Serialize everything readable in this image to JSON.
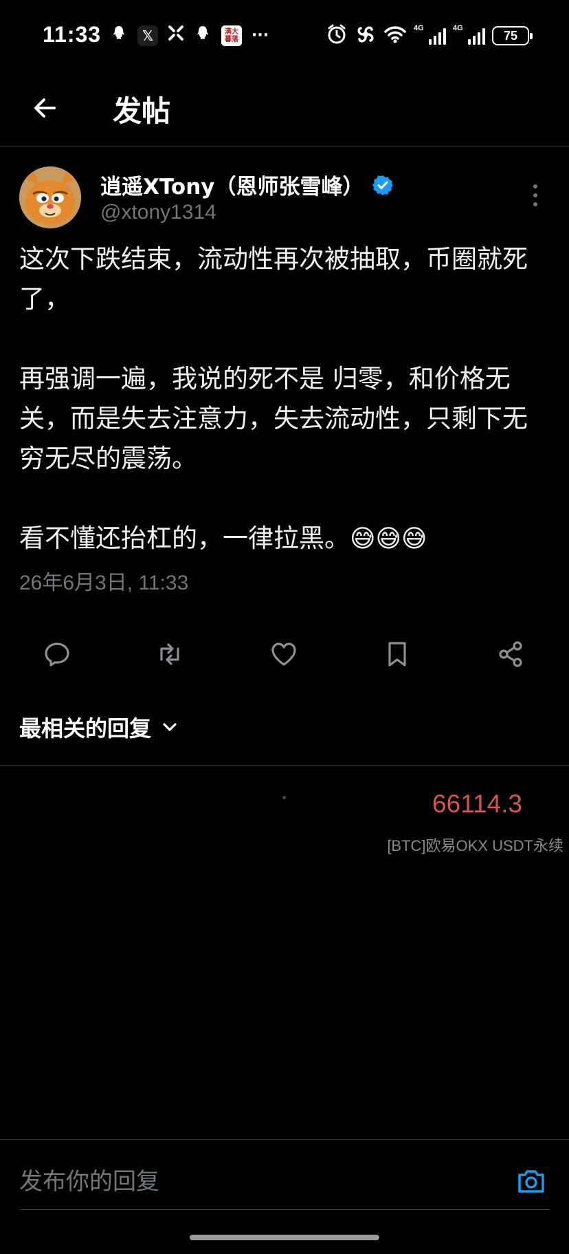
{
  "status_bar": {
    "time": "11:33",
    "left_icons": [
      "qq-icon",
      "x-icon",
      "grid-icon",
      "qq-icon",
      "app-icon",
      "more-icon"
    ],
    "app_icon_text": "满大\n暮落",
    "network_1": "4G",
    "network_2": "4G",
    "battery": "75"
  },
  "header": {
    "title": "发帖"
  },
  "post": {
    "display_name": "逍遥XTony（恩师张雪峰）",
    "handle": "@xtony1314",
    "paragraphs": [
      "这次下跌结束，流动性再次被抽取，币圈就死了，",
      "再强调一遍，我说的死不是 归零，和价格无关，而是失去注意力，失去流动性，只剩下无穷无尽的震荡。",
      "看不懂还抬杠的，一律拉黑。"
    ],
    "emoji": "😅😅😅",
    "timestamp": "26年6月3日, 11:33"
  },
  "actions": [
    "reply-icon",
    "retweet-icon",
    "like-icon",
    "bookmark-icon",
    "share-icon"
  ],
  "replies": {
    "sort_label": "最相关的回复"
  },
  "overlay": {
    "btc_price": "66114.3",
    "btc_label": "[BTC]欧易OKX USDT永续"
  },
  "composer": {
    "placeholder": "发布你的回复"
  },
  "colors": {
    "background": "#000000",
    "accent_blue": "#1d9bf0",
    "secondary_text": "#71767b",
    "price_red": "#d9534a"
  }
}
